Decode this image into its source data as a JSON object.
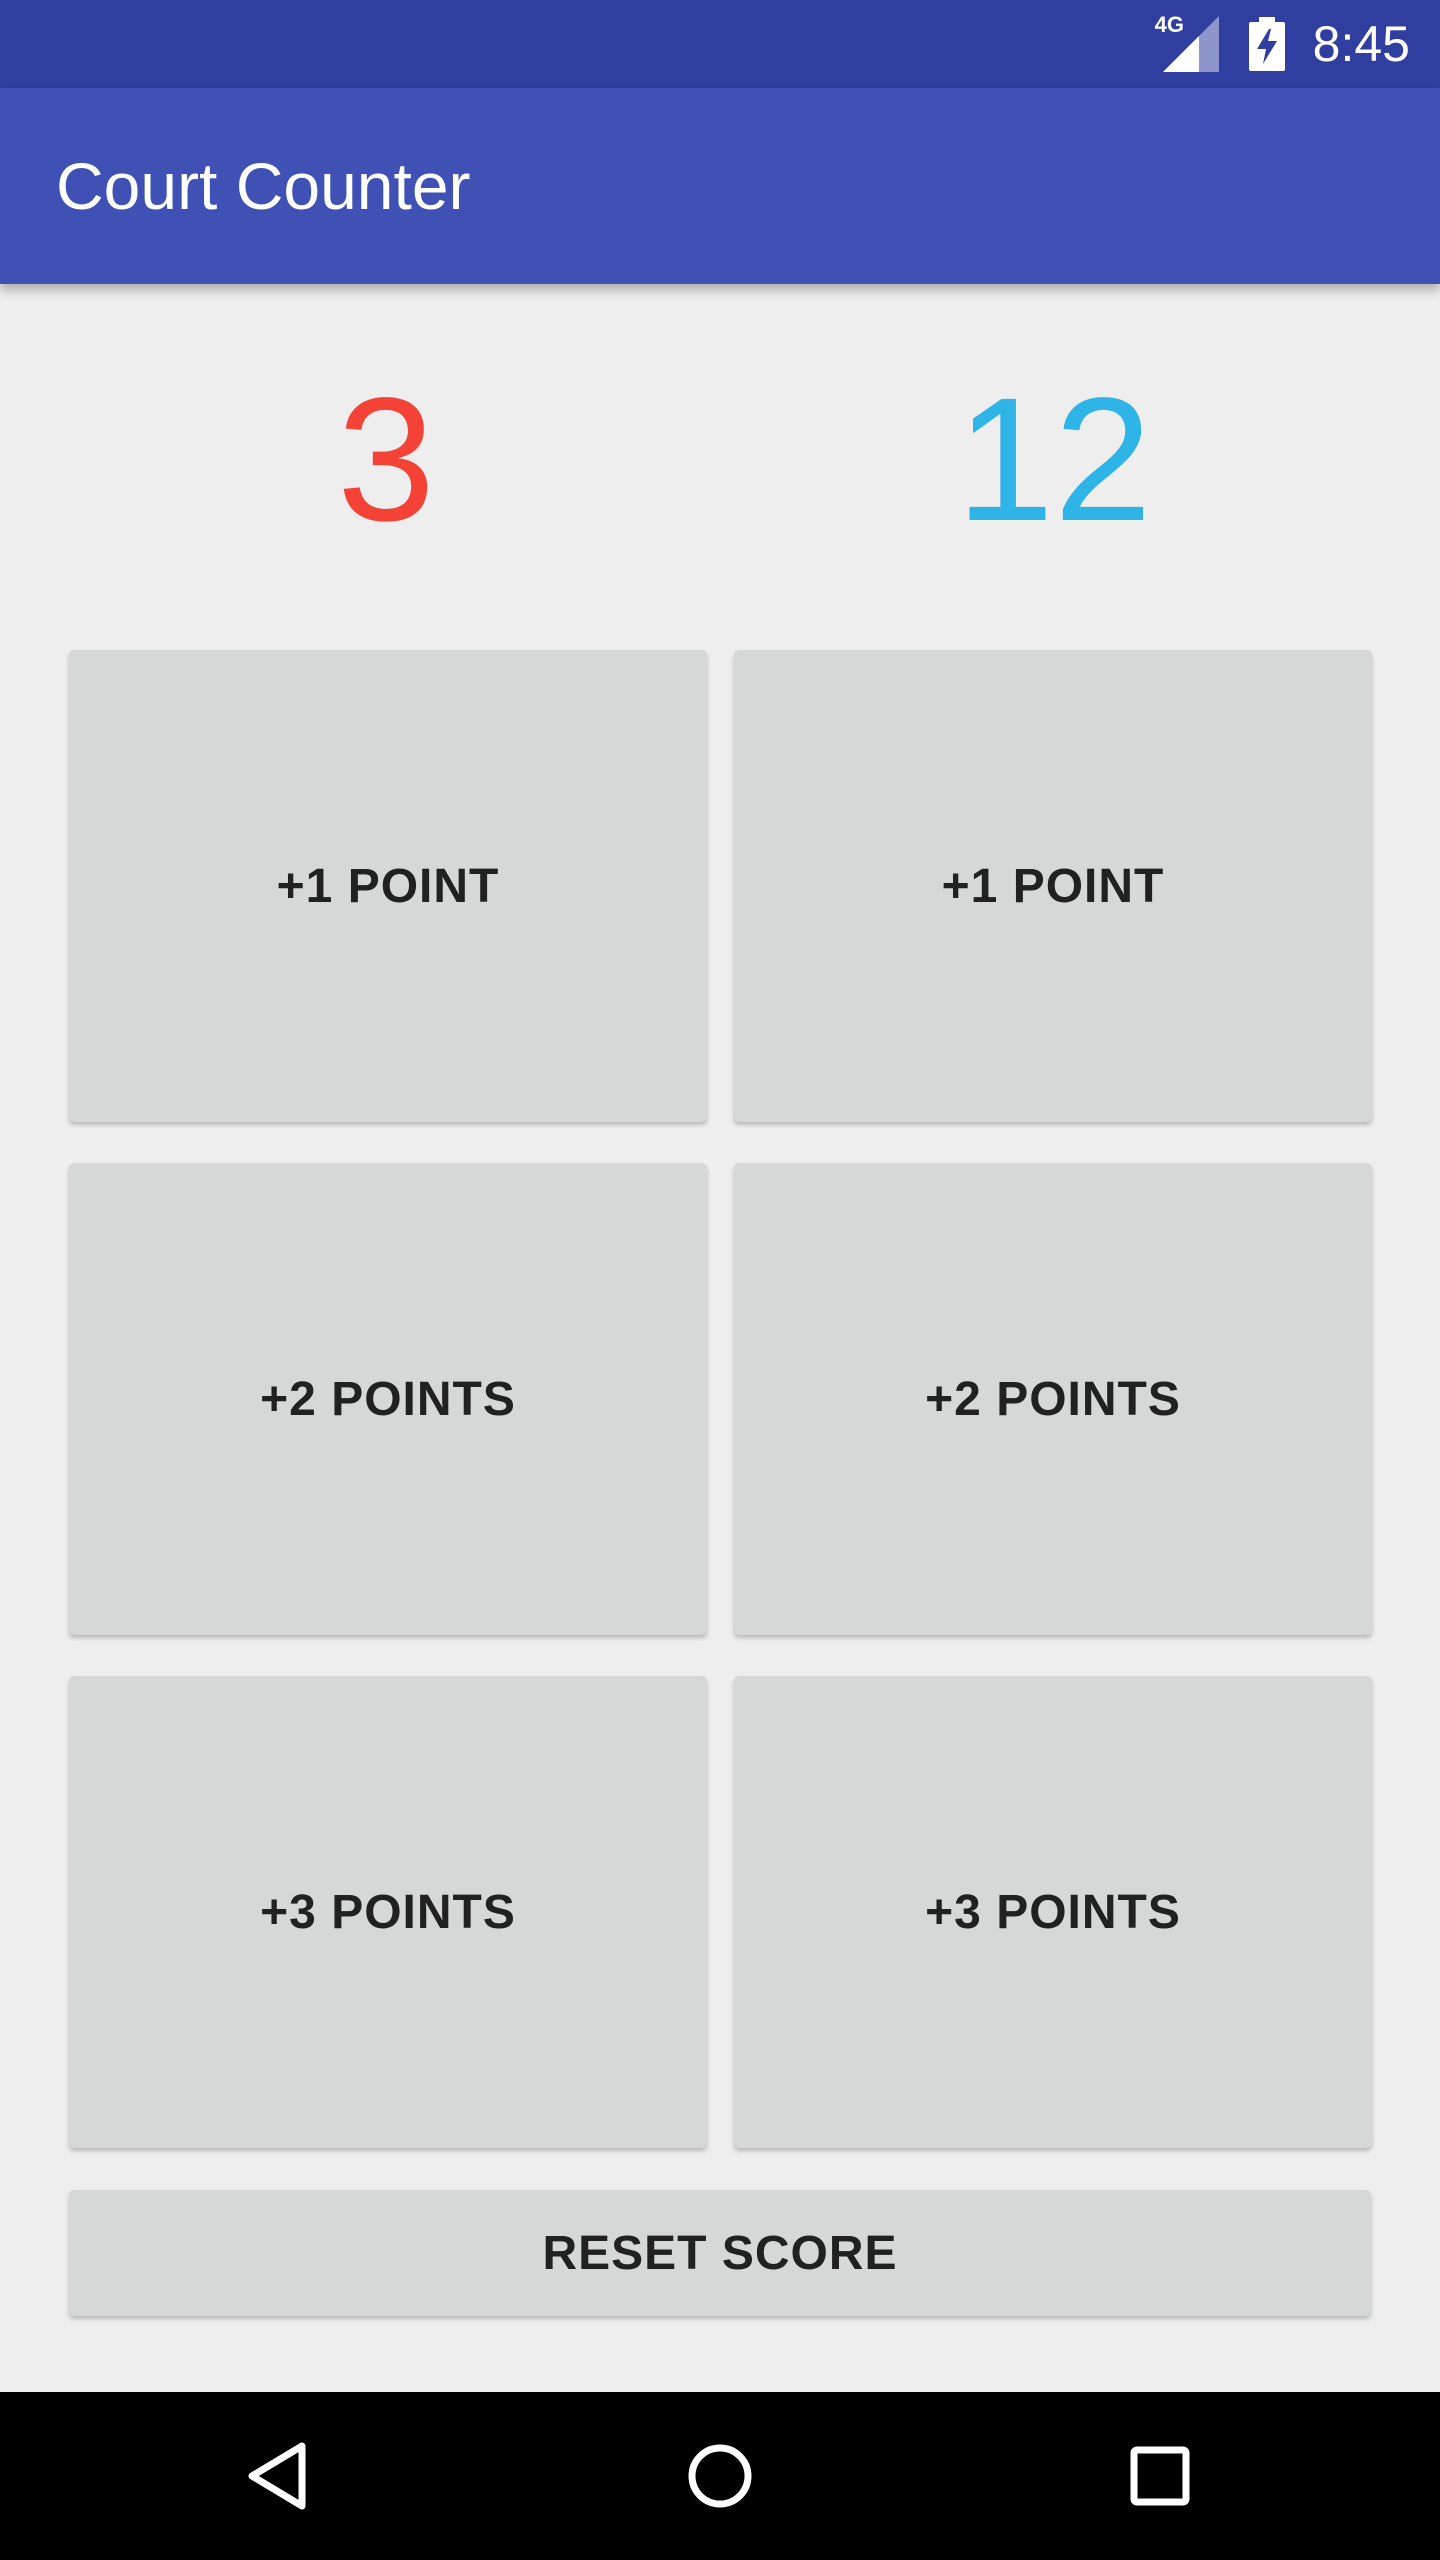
{
  "status_bar": {
    "network": "4G",
    "time": "8:45",
    "icons": [
      "signal-icon",
      "battery-charging-icon"
    ]
  },
  "app_bar": {
    "title": "Court Counter",
    "color": "#3f51b5",
    "status_color": "#303f9f"
  },
  "scores": {
    "team_a": {
      "value": "3",
      "color": "#f44336"
    },
    "team_b": {
      "value": "12",
      "color": "#2eb4e6"
    }
  },
  "buttons": {
    "team_a": [
      {
        "label": "+1 POINT"
      },
      {
        "label": "+2 POINTS"
      },
      {
        "label": "+3 POINTS"
      }
    ],
    "team_b": [
      {
        "label": "+1 POINT"
      },
      {
        "label": "+2 POINTS"
      },
      {
        "label": "+3 POINTS"
      }
    ]
  },
  "reset": {
    "label": "RESET SCORE"
  },
  "nav_bar": {
    "icons": [
      "back-icon",
      "home-icon",
      "recents-icon"
    ]
  }
}
